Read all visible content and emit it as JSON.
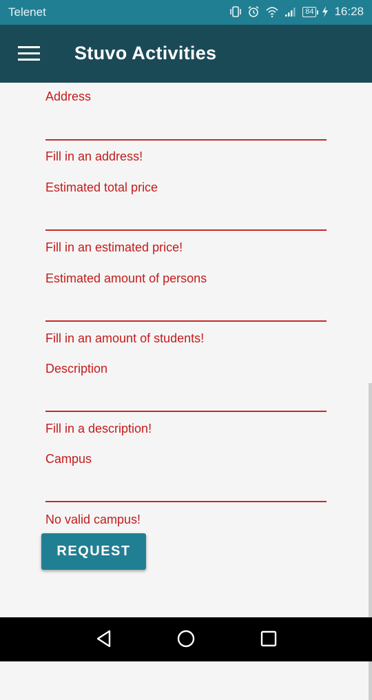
{
  "status_bar": {
    "carrier": "Telenet",
    "battery": "84",
    "time": "16:28"
  },
  "app_bar": {
    "title": "Stuvo Activities"
  },
  "form": {
    "fields": [
      {
        "label": "Address",
        "value": "",
        "error": "Fill in an address!"
      },
      {
        "label": "Estimated total price",
        "value": "",
        "error": "Fill in an estimated price!"
      },
      {
        "label": "Estimated amount of persons",
        "value": "",
        "error": "Fill in an amount of students!"
      },
      {
        "label": "Description",
        "value": "",
        "error": "Fill in a description!"
      },
      {
        "label": "Campus",
        "value": "",
        "error": "No valid campus!"
      }
    ],
    "submit_label": "REQUEST",
    "error_color": "#c41b1b"
  },
  "colors": {
    "status_bar": "#217f93",
    "app_bar": "#1b4a57",
    "accent": "#217f93"
  }
}
